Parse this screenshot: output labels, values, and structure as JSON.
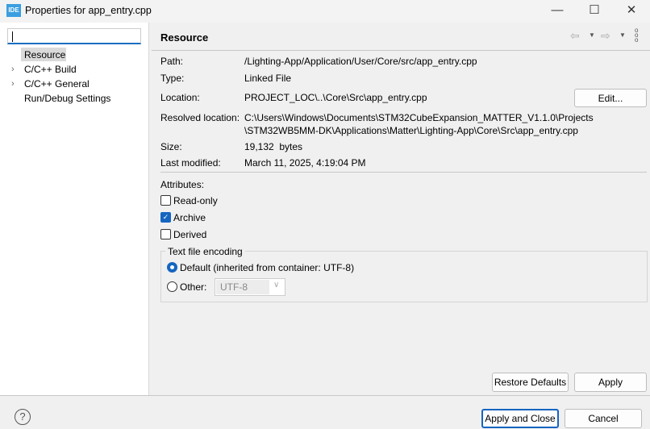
{
  "window": {
    "title": "Properties for app_entry.cpp",
    "logo": "IDE",
    "minimize": "—",
    "maximize": "☐",
    "close": "✕"
  },
  "sidebar": {
    "filter_value": "",
    "items": [
      {
        "label": "Resource",
        "selected": true
      },
      {
        "label": "C/C++ Build",
        "expandable": true
      },
      {
        "label": "C/C++ General",
        "expandable": true
      },
      {
        "label": "Run/Debug Settings"
      }
    ]
  },
  "page": {
    "title": "Resource",
    "fields": {
      "path_label": "Path:",
      "path": "/Lighting-App/Application/User/Core/src/app_entry.cpp",
      "type_label": "Type:",
      "type": "Linked File",
      "location_label": "Location:",
      "location": "PROJECT_LOC\\..\\Core\\Src\\app_entry.cpp",
      "edit_button": "Edit...",
      "resolved_label": "Resolved location:",
      "resolved_line1": "C:\\Users\\Windows\\Documents\\STM32CubeExpansion_MATTER_V1.1.0\\Projects",
      "resolved_line2": "\\STM32WB5MM-DK\\Applications\\Matter\\Lighting-App\\Core\\Src\\app_entry.cpp",
      "size_label": "Size:",
      "size": "19,132  bytes",
      "modified_label": "Last modified:",
      "modified": "March 11, 2025, 4:19:04 PM"
    },
    "attributes": {
      "label": "Attributes:",
      "read_only": {
        "label": "Read-only",
        "checked": false
      },
      "archive": {
        "label": "Archive",
        "checked": true
      },
      "derived": {
        "label": "Derived",
        "checked": false
      }
    },
    "encoding": {
      "group_label": "Text file encoding",
      "default_label": "Default (inherited from container: UTF-8)",
      "other_label": "Other:",
      "other_value": "UTF-8",
      "selected": "default"
    },
    "restore_defaults": "Restore Defaults",
    "apply": "Apply"
  },
  "footer": {
    "apply_close": "Apply and Close",
    "cancel": "Cancel",
    "help": "?"
  }
}
